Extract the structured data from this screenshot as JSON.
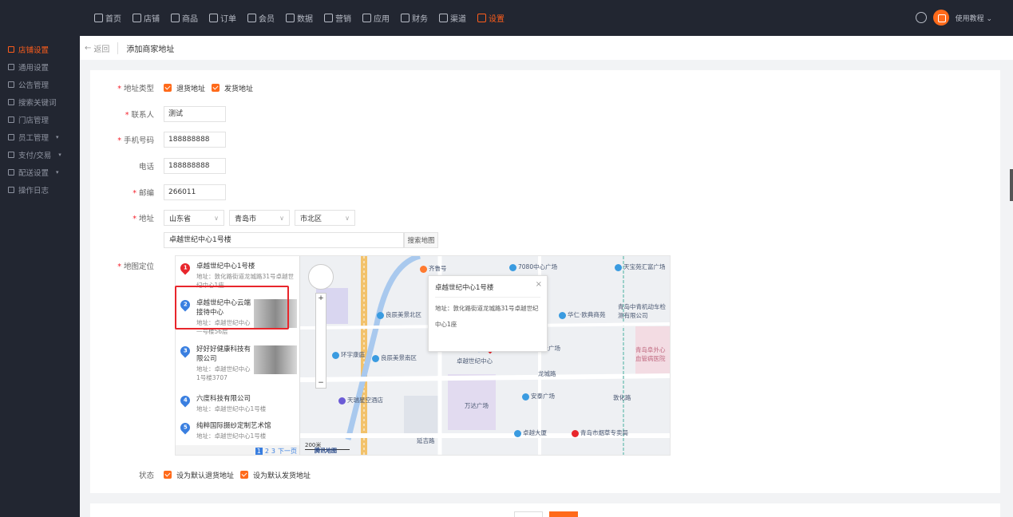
{
  "topnav": {
    "items": [
      {
        "label": "首页",
        "icon": "home-icon"
      },
      {
        "label": "店铺",
        "icon": "store-icon"
      },
      {
        "label": "商品",
        "icon": "goods-icon"
      },
      {
        "label": "订单",
        "icon": "order-icon"
      },
      {
        "label": "会员",
        "icon": "member-icon"
      },
      {
        "label": "数据",
        "icon": "data-icon"
      },
      {
        "label": "营销",
        "icon": "marketing-icon"
      },
      {
        "label": "应用",
        "icon": "app-icon"
      },
      {
        "label": "财务",
        "icon": "finance-icon"
      },
      {
        "label": "渠道",
        "icon": "channel-icon"
      },
      {
        "label": "设置",
        "icon": "settings-icon"
      }
    ],
    "active": "设置",
    "user_label": "使用教程 ⌄",
    "accent": "#ff5d1b"
  },
  "sidebar": {
    "items": [
      {
        "label": "店铺设置",
        "active": true
      },
      {
        "label": "通用设置"
      },
      {
        "label": "公告管理"
      },
      {
        "label": "搜索关键词"
      },
      {
        "label": "门店管理"
      },
      {
        "label": "员工管理",
        "arrow": "▾"
      },
      {
        "label": "支付/交易",
        "arrow": "▾"
      },
      {
        "label": "配送设置",
        "arrow": "▾"
      },
      {
        "label": "操作日志"
      }
    ]
  },
  "breadcrumb": {
    "back": "返回",
    "title": "添加商家地址"
  },
  "form": {
    "address_type": {
      "label": "地址类型",
      "opt1": "退货地址",
      "opt2": "发货地址"
    },
    "contact": {
      "label": "联系人",
      "value": "测试"
    },
    "mobile": {
      "label": "手机号码",
      "value": "188888888"
    },
    "phone": {
      "label": "电话",
      "value": "188888888"
    },
    "zipcode": {
      "label": "邮编",
      "value": "266011"
    },
    "address": {
      "label": "地址",
      "province": "山东省",
      "city": "青岛市",
      "district": "市北区",
      "detail": "卓越世纪中心1号楼",
      "search_btn": "搜索地图"
    },
    "map_label": "地图定位",
    "status": {
      "label": "状态",
      "opt1": "设为默认退货地址",
      "opt2": "设为默认发货地址"
    }
  },
  "map": {
    "results": [
      {
        "num": "1",
        "title": "卓越世纪中心1号楼",
        "sub": "地址：敦化路街道龙城路31号卓越世纪中心1座"
      },
      {
        "num": "2",
        "title": "卓越世纪中心云端接待中心",
        "sub": "地址：卓越世纪中心一号楼56层"
      },
      {
        "num": "3",
        "title": "好好好健康科技有限公司",
        "sub": "地址：卓越世纪中心1号楼3707"
      },
      {
        "num": "4",
        "title": "六度科技有限公司",
        "sub": "地址：卓越世纪中心1号楼"
      },
      {
        "num": "5",
        "title": "纯粹国际摄纱定制艺术馆",
        "sub": "地址：卓越世纪中心1号楼"
      }
    ],
    "pager": {
      "pages": [
        "1",
        "2",
        "3"
      ],
      "next": "下一页"
    },
    "info": {
      "title": "卓越世纪中心1号楼",
      "sub": "地址：敦化路街道龙城路31号卓越世纪中心1座"
    },
    "pois": [
      "齐鲁号",
      "7080中心广场",
      "天宝苑汇富广场",
      "良辰美景北区",
      "华仁·欧典商苑",
      "青岛中青机动车检测有限公司",
      "环宇康庭",
      "良辰美景南区",
      "卓越世纪中心",
      "凯景广场",
      "龙城路",
      "天瑞星空酒店",
      "万达广场",
      "安泰广场",
      "敦化路",
      "卓越大厦",
      "青岛市烟草专卖局",
      "延吉路",
      "青岛阜外心血管病医院"
    ],
    "scale": "200米",
    "logo": "腾讯地图"
  }
}
